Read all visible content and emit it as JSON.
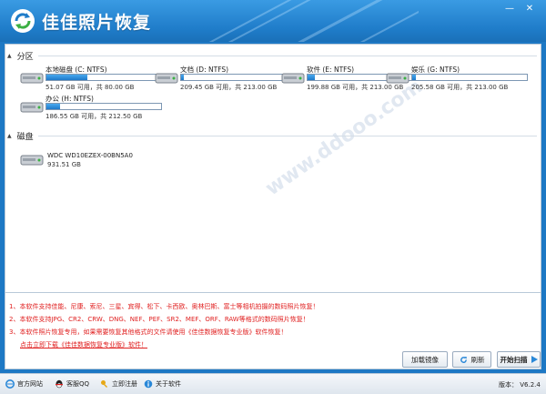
{
  "app": {
    "title": "佳佳照片恢复",
    "minimize_glyph": "—",
    "close_glyph": "✕"
  },
  "sections": {
    "partitions": "分区",
    "disks": "磁盘"
  },
  "partitions": [
    {
      "name": "本地磁盘 (C: NTFS)",
      "used_fraction": 0.36,
      "size": "51.07 GB 可用，共 80.00 GB"
    },
    {
      "name": "文档 (D: NTFS)",
      "used_fraction": 0.02,
      "size": "209.45 GB 可用，共 213.00 GB"
    },
    {
      "name": "软件 (E: NTFS)",
      "used_fraction": 0.06,
      "size": "199.88 GB 可用，共 213.00 GB"
    },
    {
      "name": "娱乐 (G: NTFS)",
      "used_fraction": 0.03,
      "size": "205.58 GB 可用，共 213.00 GB"
    },
    {
      "name": "办公 (H: NTFS)",
      "used_fraction": 0.12,
      "size": "186.55 GB 可用，共 212.50 GB"
    }
  ],
  "physical_disk": {
    "name": "WDC WD10EZEX-00BN5A0",
    "size": "931.51 GB"
  },
  "notes": [
    "1、本软件支持佳能、尼康、索尼、三星、宾得、松下、卡西欧、奥林巴斯、富士等相机拍摄的数码照片恢复！",
    "2、本软件支持JPG、CR2、CRW、DNG、NEF、PEF、SR2、MEF、ORF、RAW等格式的数码照片恢复！",
    "3、本软件照片恢复专用，如果需要恢复其他格式的文件请使用《佳佳数据恢复专业版》软件恢复！",
    "点击立即下载《佳佳数据恢复专业版》软件！"
  ],
  "buttons": {
    "load_image": "加载镜像",
    "refresh": "刷新",
    "start_scan": "开始扫描"
  },
  "statusbar": {
    "website": "官方网站",
    "qq": "客服QQ",
    "register": "立即注册",
    "about": "关于软件",
    "version": "版本： V6.2.4"
  },
  "colors": {
    "titlebar": "#1f7cc9",
    "progress": "#2a88d8",
    "note_text": "#e02020"
  }
}
